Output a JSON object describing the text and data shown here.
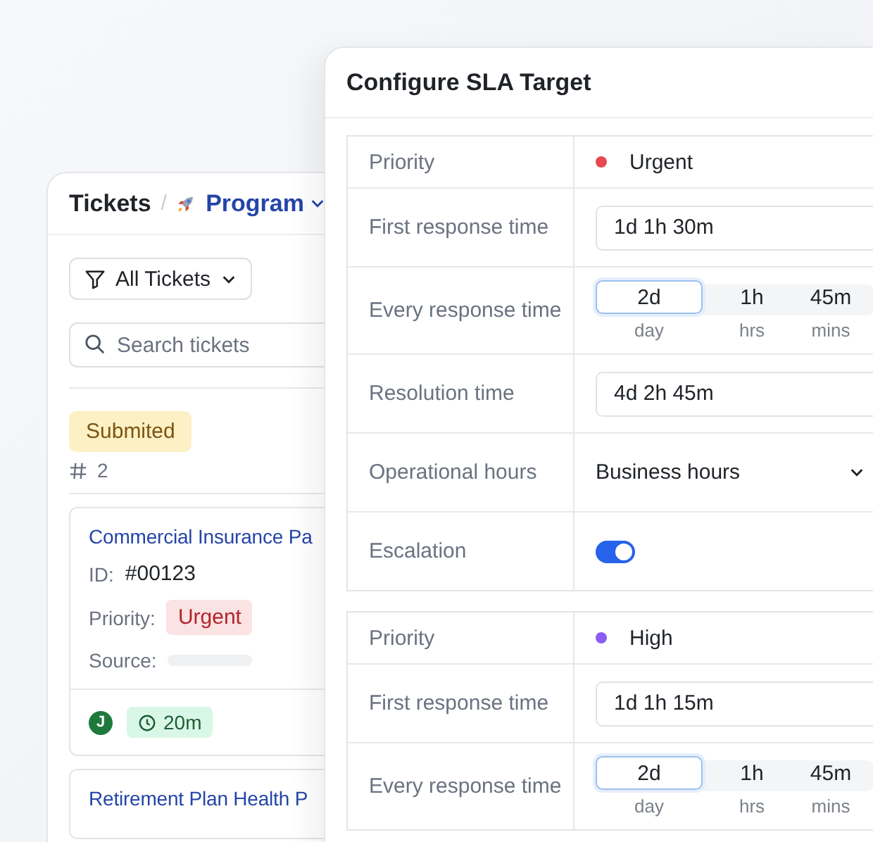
{
  "tickets_panel": {
    "title": "Tickets",
    "separator": "/",
    "breadcrumb": "Program",
    "filter": "All Tickets",
    "search": {
      "placeholder": "Search tickets"
    },
    "group": {
      "status": "Submited",
      "count": "2"
    },
    "cards": [
      {
        "title": "Commercial Insurance Pa",
        "id_label": "ID:",
        "id": "#00123",
        "priority_label": "Priority:",
        "priority": "Urgent",
        "source_label": "Source:",
        "assignee_initial": "J",
        "timer": "20m"
      },
      {
        "title": "Retirement Plan Health P"
      }
    ]
  },
  "sla_panel": {
    "title": "Configure SLA Target",
    "targets": [
      {
        "rows": [
          {
            "kind": "priority",
            "label": "Priority",
            "value": "Urgent",
            "color": "#e5484d"
          },
          {
            "kind": "field",
            "label": "First response time",
            "value": "1d 1h 30m"
          },
          {
            "kind": "segments",
            "label": "Every response time",
            "segments": [
              {
                "value": "2d",
                "unit": "day",
                "selected": true
              },
              {
                "value": "1h",
                "unit": "hrs",
                "selected": false
              },
              {
                "value": "45m",
                "unit": "mins",
                "selected": false
              }
            ]
          },
          {
            "kind": "field",
            "label": "Resolution time",
            "value": "4d 2h 45m"
          },
          {
            "kind": "select",
            "label": "Operational hours",
            "value": "Business hours"
          },
          {
            "kind": "toggle",
            "label": "Escalation",
            "on": true
          }
        ]
      },
      {
        "rows": [
          {
            "kind": "priority",
            "label": "Priority",
            "value": "High",
            "color": "#8b5cf6"
          },
          {
            "kind": "field",
            "label": "First response time",
            "value": "1d 1h 15m"
          },
          {
            "kind": "segments",
            "label": "Every response time",
            "segments": [
              {
                "value": "2d",
                "unit": "day",
                "selected": true
              },
              {
                "value": "1h",
                "unit": "hrs",
                "selected": false
              },
              {
                "value": "45m",
                "unit": "mins",
                "selected": false
              }
            ]
          }
        ]
      }
    ]
  }
}
